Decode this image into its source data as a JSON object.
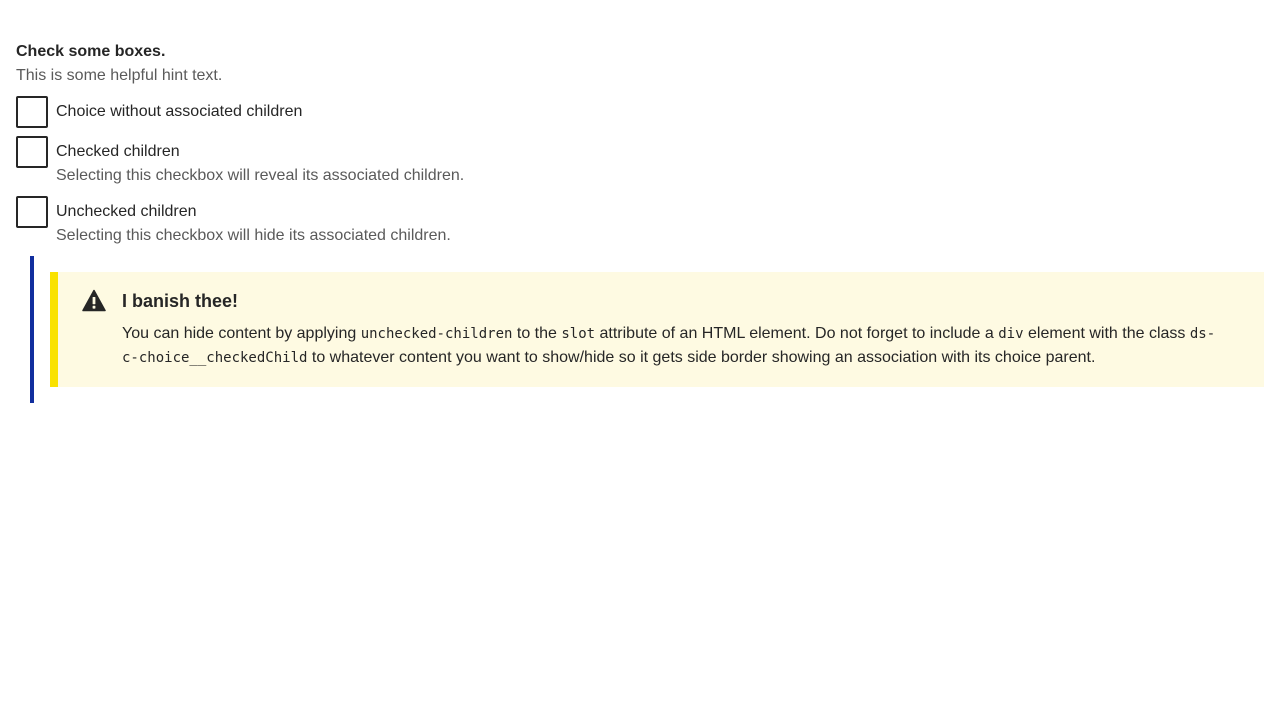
{
  "fieldset": {
    "legend": "Check some boxes.",
    "hint": "This is some helpful hint text.",
    "choices": [
      {
        "label": "Choice without associated children",
        "hint": "",
        "checked": false
      },
      {
        "label": "Checked children",
        "hint": "Selecting this checkbox will reveal its associated children.",
        "checked": false
      },
      {
        "label": "Unchecked children",
        "hint": "Selecting this checkbox will hide its associated children.",
        "checked": false
      }
    ]
  },
  "alert": {
    "icon": "warning-icon",
    "heading": "I banish thee!",
    "text": {
      "part1": "You can hide content by applying ",
      "code1": "unchecked-children",
      "part2": " to the ",
      "code2": "slot",
      "part3": " attribute of an HTML element. Do not forget to include a ",
      "code3": "div",
      "part4": " element with the class ",
      "code4": "ds-c-choice__checkedChild",
      "part5": " to whatever content you want to show/hide so it gets side border showing an association with its choice parent."
    }
  },
  "colors": {
    "checked_child_border": "#112e9e",
    "alert_accent": "#f9e200",
    "alert_background": "#fefae2"
  }
}
